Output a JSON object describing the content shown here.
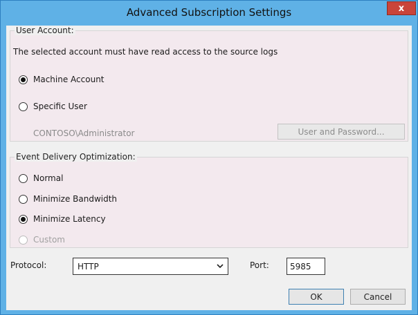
{
  "window": {
    "title": "Advanced Subscription Settings",
    "close_label": "x"
  },
  "user_account": {
    "legend": "User Account:",
    "description": "The selected account must have read access to the source logs",
    "options": [
      {
        "label": "Machine Account",
        "selected": true
      },
      {
        "label": "Specific User",
        "selected": false
      }
    ],
    "account_name": "CONTOSO\\Administrator",
    "user_password_button": "User and Password..."
  },
  "event_delivery": {
    "legend": "Event Delivery Optimization:",
    "options": [
      {
        "label": "Normal",
        "selected": false,
        "disabled": false
      },
      {
        "label": "Minimize Bandwidth",
        "selected": false,
        "disabled": false
      },
      {
        "label": "Minimize Latency",
        "selected": true,
        "disabled": false
      },
      {
        "label": "Custom",
        "selected": false,
        "disabled": true
      }
    ]
  },
  "protocol": {
    "label": "Protocol:",
    "value": "HTTP",
    "icon": "chevron-down-icon"
  },
  "port": {
    "label": "Port:",
    "value": "5985"
  },
  "buttons": {
    "ok": "OK",
    "cancel": "Cancel"
  }
}
